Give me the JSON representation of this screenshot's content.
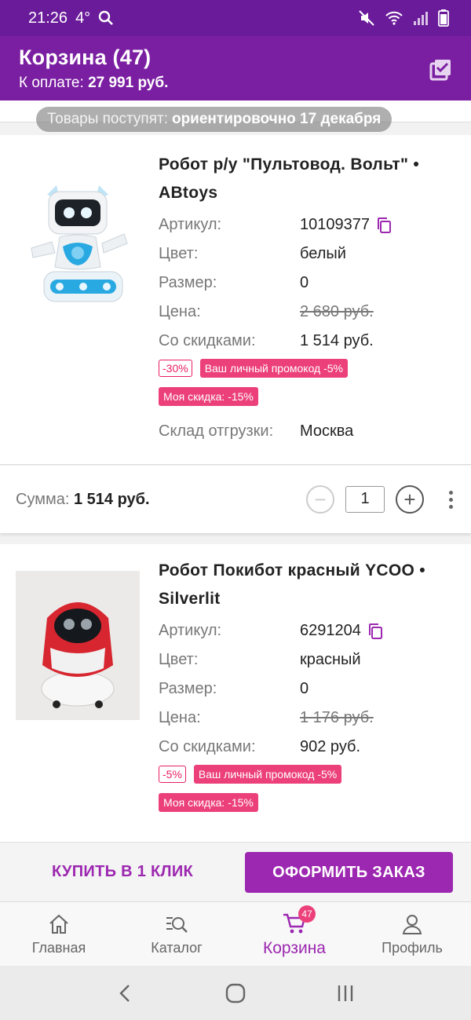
{
  "status_bar": {
    "time": "21:26",
    "temp": "4°"
  },
  "header": {
    "title": "Корзина (47)",
    "pay_label": "К оплате:",
    "pay_amount": "27 991 руб."
  },
  "delivery_notice": {
    "label": "Товары поступят:",
    "value": "ориентировочно 17 декабря"
  },
  "products": [
    {
      "name": "Робот р/у \"Пультовод. Вольт\" • ABtoys",
      "article_label": "Артикул:",
      "article": "10109377",
      "color_label": "Цвет:",
      "color": "белый",
      "size_label": "Размер:",
      "size": "0",
      "price_label": "Цена:",
      "price": "2 680 руб.",
      "discount_price_label": "Со скидками:",
      "discount_price": "1 514 руб.",
      "discount_badge": "-30%",
      "promo_badge": "Ваш личный промокод -5%",
      "my_discount_badge": "Моя скидка: -15%",
      "stock_label": "Склад отгрузки:",
      "stock": "Москва",
      "sum_label": "Сумма:",
      "sum": "1 514 руб.",
      "quantity": "1"
    },
    {
      "name": "Робот Покибот красный YCOO • Silverlit",
      "article_label": "Артикул:",
      "article": "6291204",
      "color_label": "Цвет:",
      "color": "красный",
      "size_label": "Размер:",
      "size": "0",
      "price_label": "Цена:",
      "price": "1 176 руб.",
      "discount_price_label": "Со скидками:",
      "discount_price": "902 руб.",
      "discount_badge": "-5%",
      "promo_badge": "Ваш личный промокод -5%",
      "my_discount_badge": "Моя скидка: -15%"
    }
  ],
  "actions": {
    "buy_one_click": "КУПИТЬ В 1 КЛИК",
    "checkout": "ОФОРМИТЬ ЗАКАЗ"
  },
  "bottom_nav": {
    "items": [
      {
        "label": "Главная",
        "icon": "home-icon"
      },
      {
        "label": "Каталог",
        "icon": "catalog-search-icon"
      },
      {
        "label": "Корзина",
        "icon": "cart-icon",
        "badge": "47",
        "active": true
      },
      {
        "label": "Профиль",
        "icon": "profile-icon"
      }
    ]
  },
  "colors": {
    "primary": "#7b1fa2",
    "accent": "#9c27b0",
    "pink": "#ec407a"
  }
}
